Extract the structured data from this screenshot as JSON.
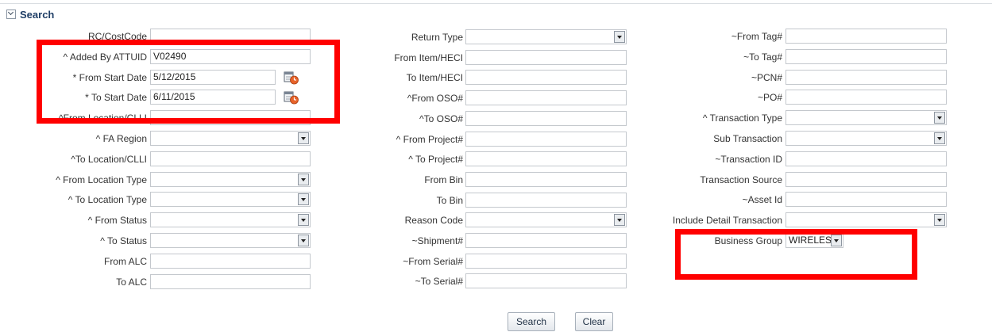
{
  "section": {
    "title": "Search",
    "toggle_icon": "collapse-toggle-icon"
  },
  "col1": [
    {
      "label": "RC/CostCode",
      "type": "text",
      "value": ""
    },
    {
      "label": "^ Added By ATTUID",
      "type": "text",
      "value": "V02490"
    },
    {
      "label": "* From Start Date",
      "type": "date",
      "value": "5/12/2015"
    },
    {
      "label": "* To Start Date",
      "type": "date",
      "value": "6/11/2015"
    },
    {
      "label": "^From Location/CLLI",
      "type": "text",
      "value": ""
    },
    {
      "label": "^ FA Region",
      "type": "select",
      "value": ""
    },
    {
      "label": "^To Location/CLLI",
      "type": "text",
      "value": ""
    },
    {
      "label": "^ From Location Type",
      "type": "select",
      "value": ""
    },
    {
      "label": "^ To Location Type",
      "type": "select",
      "value": ""
    },
    {
      "label": "^ From Status",
      "type": "select",
      "value": ""
    },
    {
      "label": "^ To Status",
      "type": "select",
      "value": ""
    },
    {
      "label": "From ALC",
      "type": "text",
      "value": ""
    },
    {
      "label": "To ALC",
      "type": "text",
      "value": ""
    }
  ],
  "col2": [
    {
      "label": "Return Type",
      "type": "select",
      "value": ""
    },
    {
      "label": "From Item/HECI",
      "type": "text",
      "value": ""
    },
    {
      "label": "To Item/HECI",
      "type": "text",
      "value": ""
    },
    {
      "label": "^From OSO#",
      "type": "text",
      "value": ""
    },
    {
      "label": "^To OSO#",
      "type": "text",
      "value": ""
    },
    {
      "label": "^ From Project#",
      "type": "text",
      "value": ""
    },
    {
      "label": "^ To Project#",
      "type": "text",
      "value": ""
    },
    {
      "label": "From Bin",
      "type": "text",
      "value": ""
    },
    {
      "label": "To Bin",
      "type": "text",
      "value": ""
    },
    {
      "label": "Reason Code",
      "type": "select",
      "value": ""
    },
    {
      "label": "~Shipment#",
      "type": "text",
      "value": ""
    },
    {
      "label": "~From Serial#",
      "type": "text",
      "value": ""
    },
    {
      "label": "~To Serial#",
      "type": "text",
      "value": ""
    }
  ],
  "col3": [
    {
      "label": "~From Tag#",
      "type": "text",
      "value": ""
    },
    {
      "label": "~To Tag#",
      "type": "text",
      "value": ""
    },
    {
      "label": "~PCN#",
      "type": "text",
      "value": ""
    },
    {
      "label": "~PO#",
      "type": "text",
      "value": ""
    },
    {
      "label": "^ Transaction Type",
      "type": "select",
      "value": ""
    },
    {
      "label": "Sub Transaction",
      "type": "select",
      "value": ""
    },
    {
      "label": "~Transaction ID",
      "type": "text",
      "value": ""
    },
    {
      "label": "Transaction Source",
      "type": "text",
      "value": ""
    },
    {
      "label": "~Asset Id",
      "type": "text",
      "value": ""
    },
    {
      "label": "Include Detail Transaction",
      "type": "select",
      "value": ""
    },
    {
      "label": "Business Group",
      "type": "select",
      "value": "WIRELESS"
    }
  ],
  "buttons": {
    "search": "Search",
    "clear": "Clear"
  },
  "colors": {
    "highlight": "#ff0000",
    "section_title": "#1f3e66"
  }
}
